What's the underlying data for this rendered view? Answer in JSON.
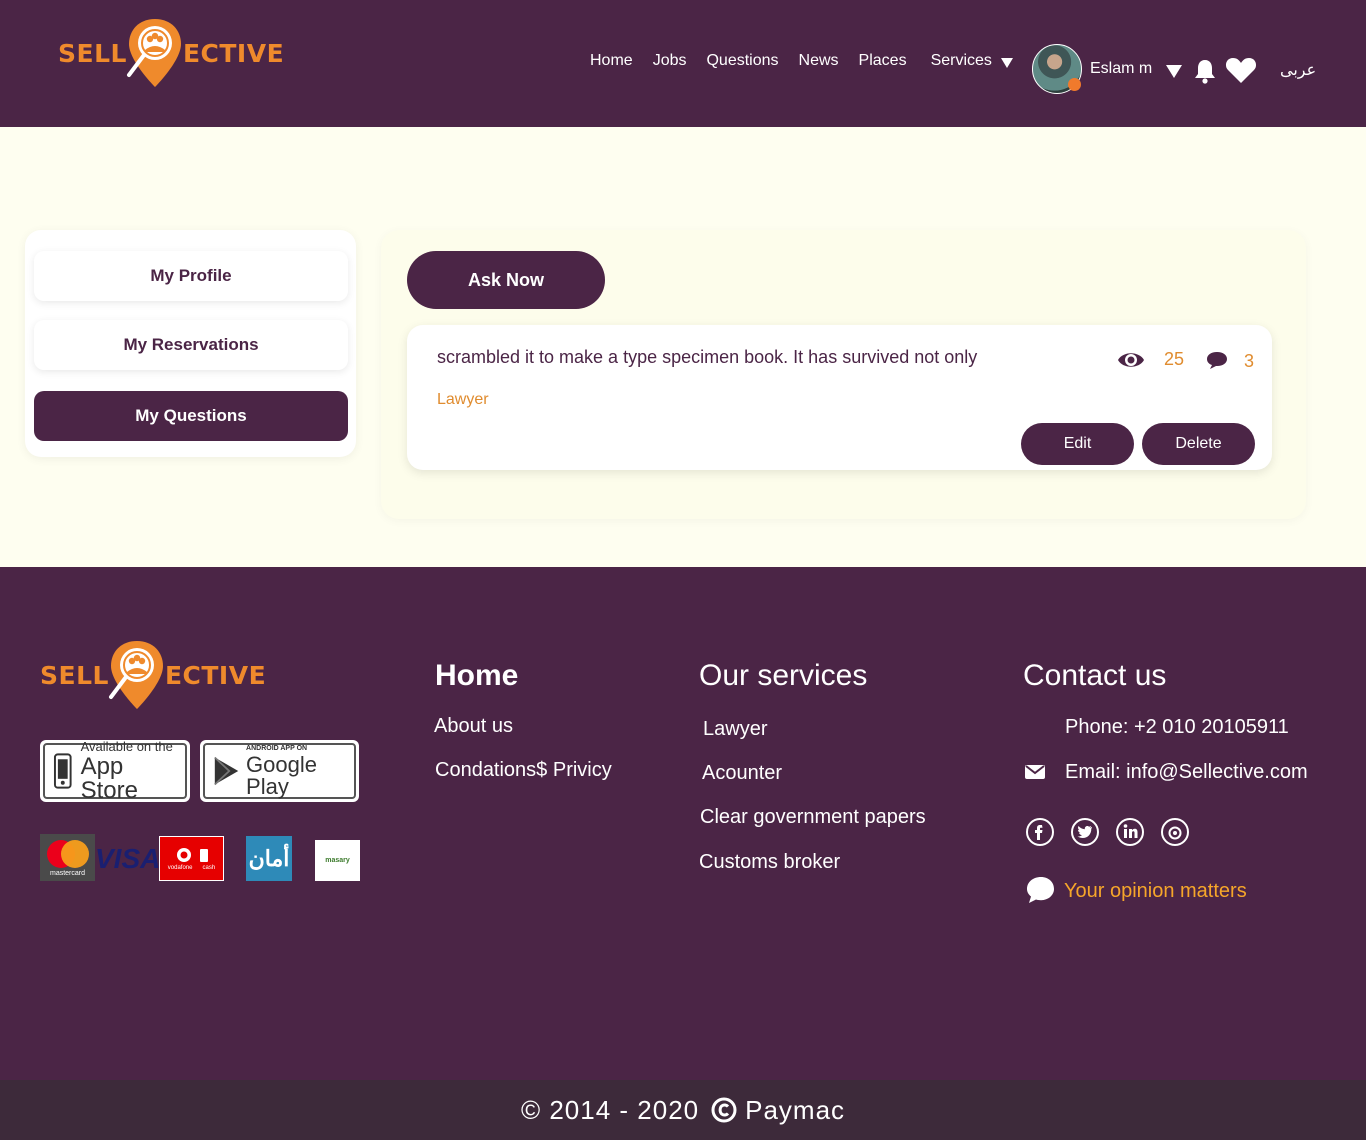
{
  "header": {
    "logo": {
      "left": "SELL",
      "right": "ECTIVE"
    },
    "nav": [
      "Home",
      "Jobs",
      "Questions",
      "News",
      "Places"
    ],
    "services_label": "Services",
    "user_name": "Eslam m",
    "language": "عربى"
  },
  "sidebar": {
    "items": [
      {
        "label": "My Profile"
      },
      {
        "label": "My Reservations"
      },
      {
        "label": "My Questions"
      }
    ]
  },
  "main": {
    "ask_button": "Ask Now",
    "question": {
      "text": "scrambled it to make a type specimen book. It has survived not only",
      "category": "Lawyer",
      "views": "25",
      "comments": "3",
      "edit_label": "Edit",
      "delete_label": "Delete"
    }
  },
  "footer": {
    "logo": {
      "left": "SELL",
      "right": "ECTIVE"
    },
    "stores": {
      "apple_top": "Available on the",
      "apple_main": "App Store",
      "google_top": "ANDROID APP ON",
      "google_main": "Google Play"
    },
    "payments": {
      "mastercard": "mastercard",
      "visa": "VISA",
      "vodafone": "vodafone",
      "vodafone_cash": "cash",
      "aman": "أمان",
      "masary": "masary"
    },
    "col_home": {
      "title": "Home",
      "links": [
        "About us",
        "Condations$ Privicy"
      ]
    },
    "col_services": {
      "title": "Our services",
      "links": [
        "Lawyer",
        "Acounter",
        "Clear government papers",
        "Customs broker"
      ]
    },
    "col_contact": {
      "title": "Contact us",
      "phone": "Phone: +2 010 20105911",
      "email": "Email: info@Sellective.com",
      "opinion": "Your opinion matters"
    },
    "copyright": "© 2014 - 2020",
    "brand": "Paymac"
  },
  "colors": {
    "brand_purple": "#4b2546",
    "brand_orange": "#ef8a2c",
    "page_bg": "#fefef0",
    "copyright_bg": "#3d2a3a"
  }
}
